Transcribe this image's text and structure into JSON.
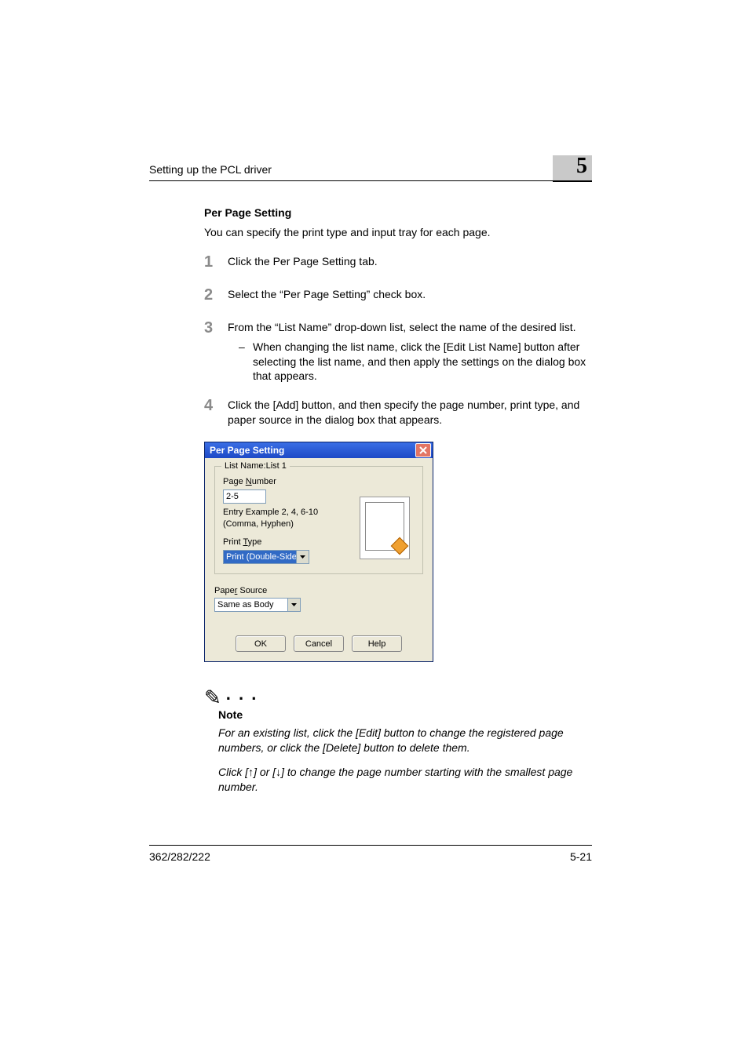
{
  "header": {
    "running": "Setting up the PCL driver",
    "chapter": "5"
  },
  "section": {
    "heading": "Per Page Setting",
    "intro": "You can specify the print type and input tray for each page."
  },
  "steps": {
    "s1": {
      "num": "1",
      "text": "Click the Per Page Setting tab."
    },
    "s2": {
      "num": "2",
      "text": "Select the “Per Page Setting” check box."
    },
    "s3": {
      "num": "3",
      "text": "From the “List Name” drop-down list, select the name of the desired list.",
      "sub_dash": "–",
      "sub": "When changing the list name, click the [Edit List Name] button after selecting the list name, and then apply the settings on the dialog box that appears."
    },
    "s4": {
      "num": "4",
      "text": "Click the [Add] button, and then specify the page number, print type, and paper source in the dialog box that appears."
    }
  },
  "dialog": {
    "title": "Per Page Setting",
    "legend": "List Name:List 1",
    "page_number_label_pre": "Page ",
    "page_number_label_u": "N",
    "page_number_label_post": "umber",
    "page_number_value": "2-5",
    "entry_hint": "Entry Example 2, 4, 6-10\n(Comma, Hyphen)",
    "print_type_label_pre": "Print ",
    "print_type_label_u": "T",
    "print_type_label_post": "ype",
    "print_type_value": "Print (Double-Sided)",
    "paper_source_label_pre": "Pape",
    "paper_source_label_u": "r",
    "paper_source_label_post": " Source",
    "paper_source_value": "Same as Body",
    "ok": "OK",
    "cancel": "Cancel",
    "help": "Help"
  },
  "note": {
    "dots": ". . .",
    "label": "Note",
    "body1": "For an existing list, click the [Edit] button to change the registered page numbers, or click the [Delete] button to delete them.",
    "body2": "Click [↑] or [↓] to change the page number starting with the smallest page number."
  },
  "footer": {
    "left": "362/282/222",
    "right": "5-21"
  }
}
